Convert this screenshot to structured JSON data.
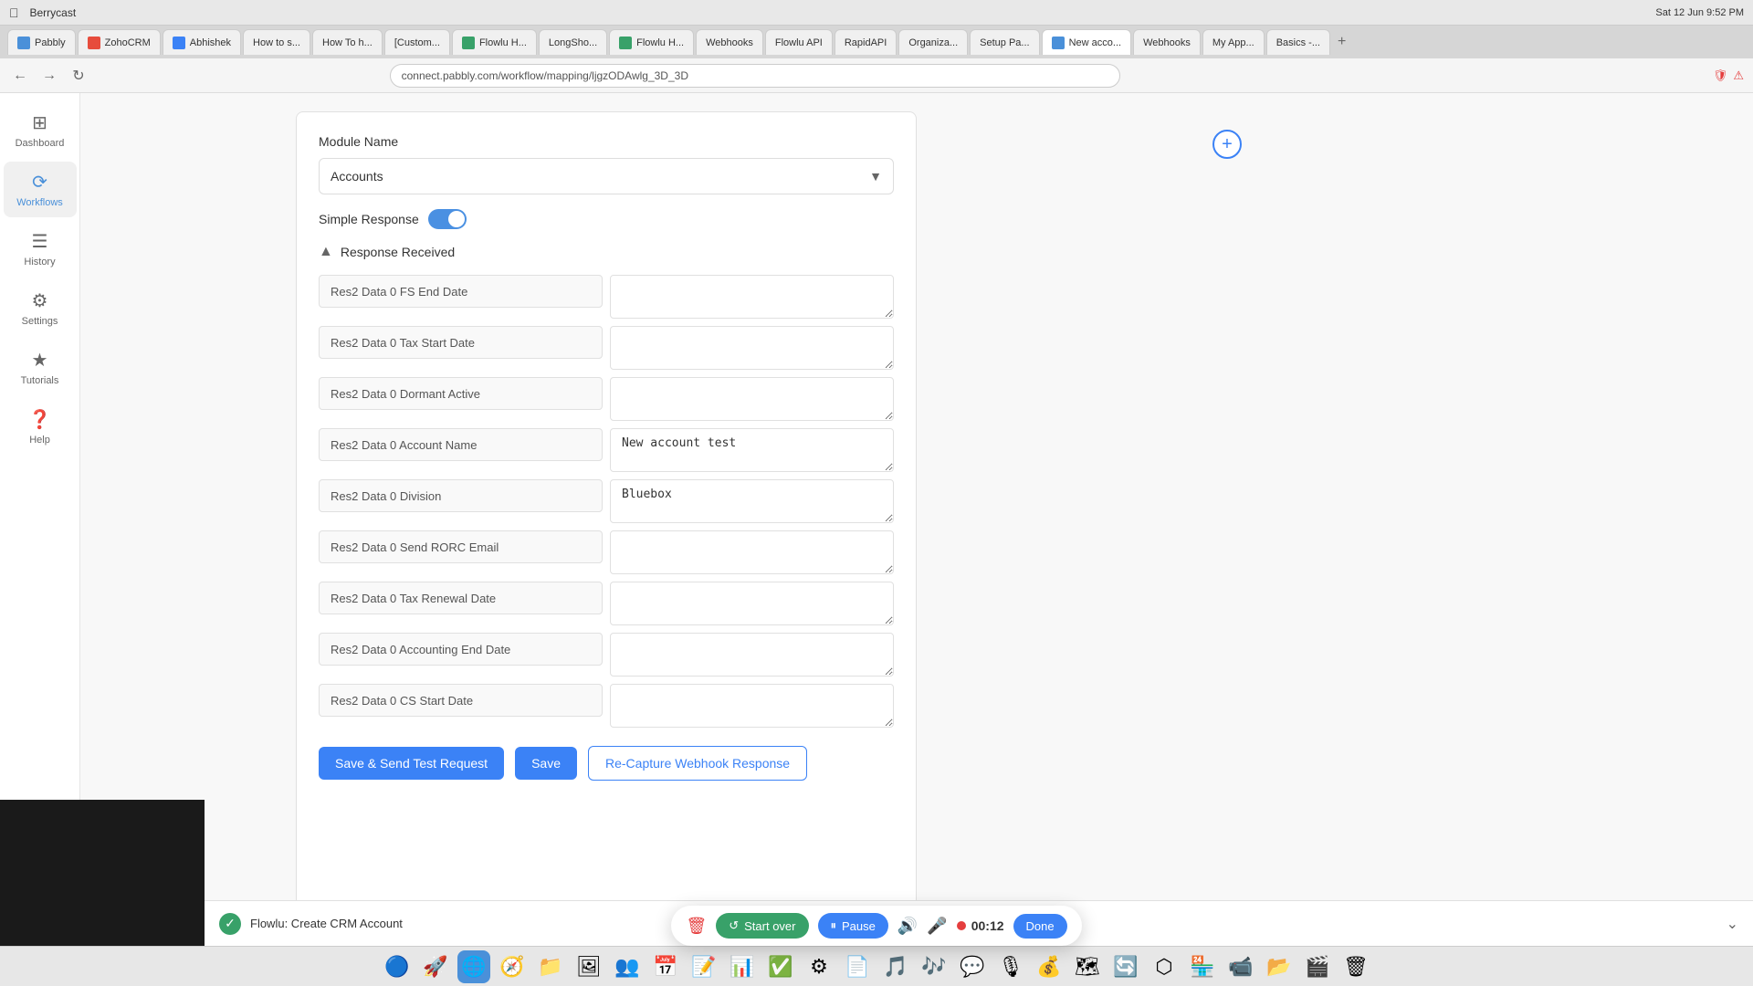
{
  "macbar": {
    "app": "Berrycast",
    "time": "Sat 12 Jun 9:52 PM"
  },
  "tabs": [
    {
      "label": "Pabbly",
      "active": false,
      "color": "#4a90d9"
    },
    {
      "label": "ZohoCRM",
      "active": false,
      "color": "#e74c3c"
    },
    {
      "label": "Abhishek",
      "active": false,
      "color": "#3498db"
    },
    {
      "label": "How to s...",
      "active": false
    },
    {
      "label": "How To h...",
      "active": false
    },
    {
      "label": "[Custom...",
      "active": false
    },
    {
      "label": "Flowlu H...",
      "active": false
    },
    {
      "label": "LongSho...",
      "active": false
    },
    {
      "label": "Flowlu H...",
      "active": false
    },
    {
      "label": "Webhooks",
      "active": false
    },
    {
      "label": "Flowlu API",
      "active": false
    },
    {
      "label": "RapidAPI",
      "active": false
    },
    {
      "label": "Organiza...",
      "active": false
    },
    {
      "label": "Setup Pa...",
      "active": false
    },
    {
      "label": "New acco...",
      "active": true
    },
    {
      "label": "Webhooks",
      "active": false
    },
    {
      "label": "My App...",
      "active": false
    },
    {
      "label": "Basics -...",
      "active": false
    }
  ],
  "url": "connect.pabbly.com/workflow/mapping/ljgzODAwlg_3D_3D",
  "sidebar": {
    "items": [
      {
        "label": "Dashboard",
        "icon": "⊞",
        "active": false
      },
      {
        "label": "Workflows",
        "icon": "⟳",
        "active": true
      },
      {
        "label": "History",
        "icon": "☰",
        "active": false
      },
      {
        "label": "Settings",
        "icon": "⚙",
        "active": false
      },
      {
        "label": "Tutorials",
        "icon": "★",
        "active": false
      },
      {
        "label": "Help",
        "icon": "?",
        "active": false
      }
    ]
  },
  "form": {
    "module_name_label": "Module Name",
    "module_value": "Accounts",
    "simple_response_label": "Simple Response",
    "response_received_label": "Response Received",
    "fields": [
      {
        "label": "Res2 Data 0 FS End Date",
        "value": ""
      },
      {
        "label": "Res2 Data 0 Tax Start Date",
        "value": ""
      },
      {
        "label": "Res2 Data 0 Dormant Active",
        "value": ""
      },
      {
        "label": "Res2 Data 0 Account Name",
        "value": "New account test"
      },
      {
        "label": "Res2 Data 0 Division",
        "value": "Bluebox"
      },
      {
        "label": "Res2 Data 0 Send RORC Email",
        "value": ""
      },
      {
        "label": "Res2 Data 0 Tax Renewal Date",
        "value": ""
      },
      {
        "label": "Res2 Data 0 Accounting End Date",
        "value": ""
      },
      {
        "label": "Res2 Data 0 CS Start Date",
        "value": ""
      }
    ],
    "btn_save_send": "Save & Send Test Request",
    "btn_save": "Save",
    "btn_recapture": "Re-Capture Webhook Response"
  },
  "recording": {
    "start_over": "Start over",
    "pause": "Pause",
    "timer": "00:12",
    "done": "Done"
  },
  "bottom_task": {
    "app": "Flowlu",
    "action": ": Create CRM Account"
  }
}
